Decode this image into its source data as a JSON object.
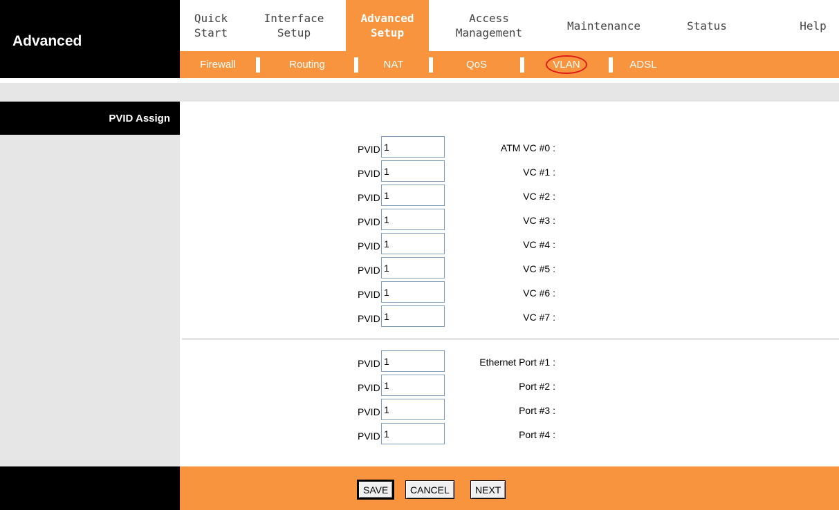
{
  "brand": {
    "title": "Advanced"
  },
  "topnav": {
    "items": [
      {
        "line1": "Quick",
        "line2": "Start"
      },
      {
        "line1": "Interface",
        "line2": "Setup"
      },
      {
        "line1": "Advanced",
        "line2": "Setup"
      },
      {
        "line1": "Access",
        "line2": "Management"
      },
      {
        "line1": "Maintenance",
        "line2": ""
      },
      {
        "line1": "Status",
        "line2": ""
      },
      {
        "line1": "Help",
        "line2": ""
      }
    ],
    "active_index": 2
  },
  "subnav": {
    "items": [
      "Firewall",
      "Routing",
      "NAT",
      "QoS",
      "VLAN",
      "ADSL"
    ],
    "highlighted": "VLAN"
  },
  "section": {
    "title": "PVID Assign"
  },
  "pvid_label": "PVID",
  "atm_rows": [
    {
      "label": "ATM VC #0 :",
      "value": "1"
    },
    {
      "label": "VC #1 :",
      "value": "1"
    },
    {
      "label": "VC #2 :",
      "value": "1"
    },
    {
      "label": "VC #3 :",
      "value": "1"
    },
    {
      "label": "VC #4 :",
      "value": "1"
    },
    {
      "label": "VC #5 :",
      "value": "1"
    },
    {
      "label": "VC #6 :",
      "value": "1"
    },
    {
      "label": "VC #7 :",
      "value": "1"
    }
  ],
  "eth_rows": [
    {
      "label": "Ethernet Port #1 :",
      "value": "1"
    },
    {
      "label": "Port #2 :",
      "value": "1"
    },
    {
      "label": "Port #3 :",
      "value": "1"
    },
    {
      "label": "Port #4 :",
      "value": "1"
    }
  ],
  "buttons": {
    "save": "SAVE",
    "cancel": "CANCEL",
    "next": "NEXT"
  },
  "colors": {
    "accent": "#f7943d",
    "black": "#000000",
    "panel_grey": "#e6e6e6",
    "highlight_ring": "#e01b1b"
  }
}
